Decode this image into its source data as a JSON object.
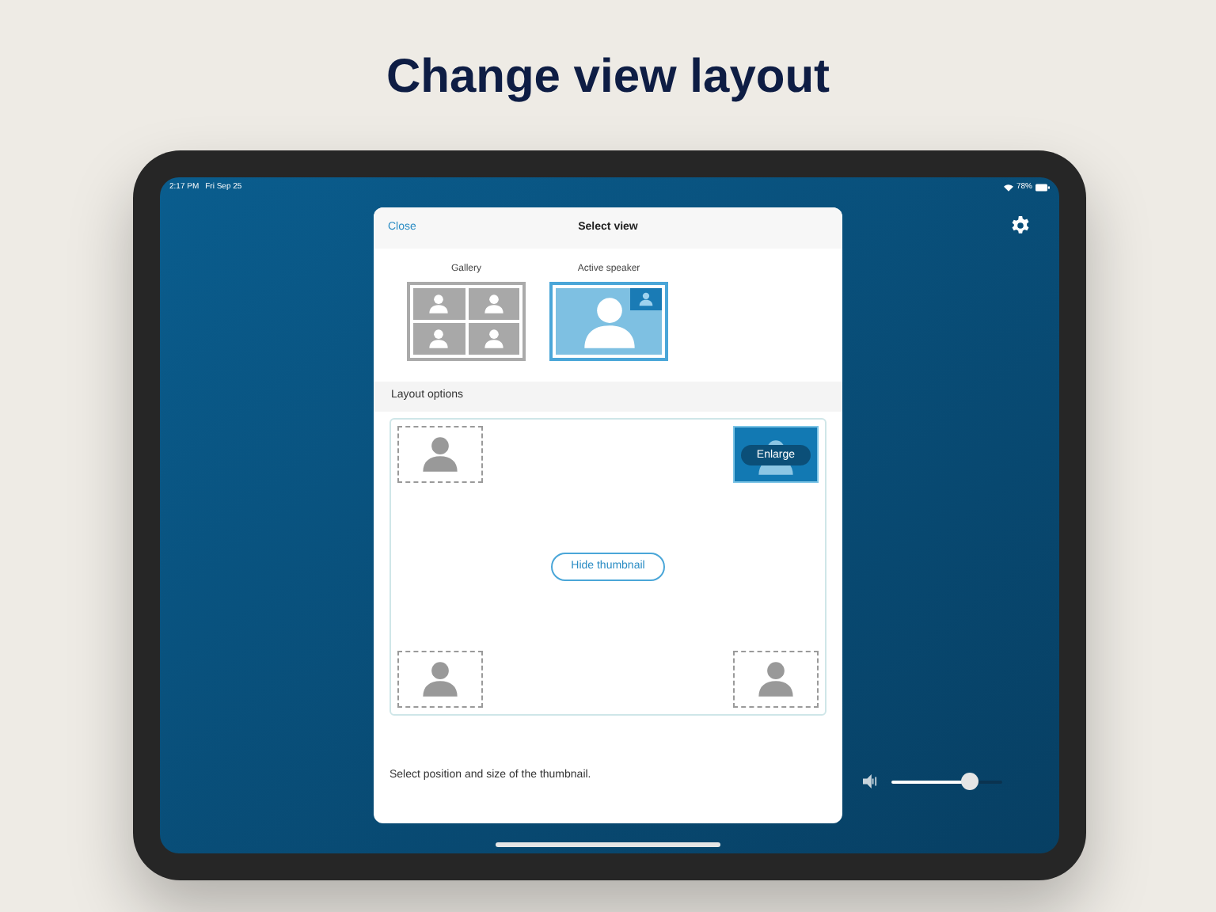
{
  "heading": "Change view layout",
  "status_bar": {
    "time": "2:17 PM",
    "date": "Fri Sep 25",
    "battery": "78%"
  },
  "dialog": {
    "close": "Close",
    "title": "Select view",
    "views": [
      {
        "label": "Gallery",
        "kind": "gallery",
        "selected": false
      },
      {
        "label": "Active speaker",
        "kind": "speaker",
        "selected": true
      }
    ],
    "section": "Layout options",
    "positions": [
      {
        "selected": false
      },
      {
        "selected": true,
        "action": "Enlarge"
      },
      {
        "selected": false
      },
      {
        "selected": false
      }
    ],
    "hide_button": "Hide thumbnail",
    "caption": "Select position and size of the thumbnail."
  },
  "volume": {
    "level": 0.7
  }
}
